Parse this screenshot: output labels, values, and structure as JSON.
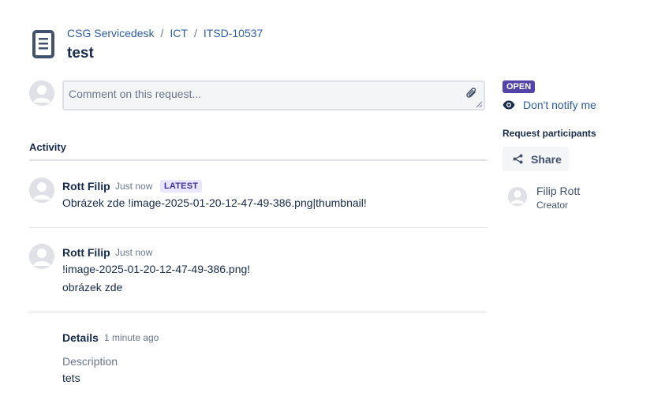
{
  "breadcrumb": {
    "items": [
      "CSG Servicedesk",
      "ICT",
      "ITSD-10537"
    ],
    "separator": "/"
  },
  "request": {
    "title": "test",
    "icon": "document-icon"
  },
  "comment": {
    "placeholder": "Comment on this request..."
  },
  "activity": {
    "heading": "Activity",
    "entries": [
      {
        "author": "Rott Filip",
        "time": "Just now",
        "badge": "LATEST",
        "lines": [
          "Obrázek zde !image-2025-01-20-12-47-49-386.png|thumbnail!"
        ]
      },
      {
        "author": "Rott Filip",
        "time": "Just now",
        "lines": [
          "!image-2025-01-20-12-47-49-386.png!",
          "obrázek zde"
        ]
      }
    ],
    "details": {
      "title": "Details",
      "time": "1 minute ago",
      "description_label": "Description",
      "description_value": "tets"
    }
  },
  "sidebar": {
    "status": "OPEN",
    "notify_label": "Don't notify me",
    "participants_heading": "Request participants",
    "share_label": "Share",
    "participant": {
      "name": "Filip Rott",
      "role": "Creator"
    }
  },
  "colors": {
    "link": "#2d5ea7",
    "status_open": "#5243aa",
    "latest_badge_bg": "#eae6ff",
    "text": "#172b4d",
    "muted": "#6b778c"
  }
}
